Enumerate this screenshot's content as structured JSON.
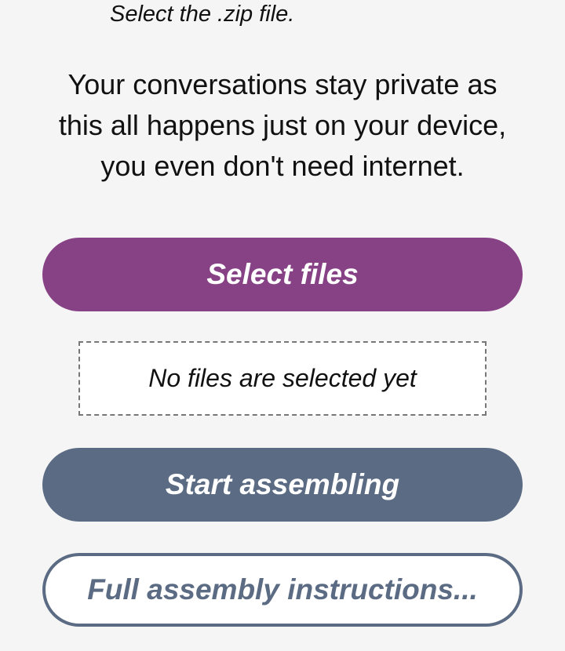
{
  "step_hint": "Select the .zip file.",
  "privacy_note": {
    "line1": "Your conversations stay private as",
    "line2": "this all happens just on your device,",
    "line3": "you even don't need internet."
  },
  "buttons": {
    "select_files": "Select files",
    "start_assembling": "Start assembling",
    "full_instructions": "Full assembly instructions..."
  },
  "file_status": "No files are selected yet",
  "colors": {
    "primary": "#874285",
    "secondary": "#5b6b83",
    "background": "#f5f5f5"
  }
}
